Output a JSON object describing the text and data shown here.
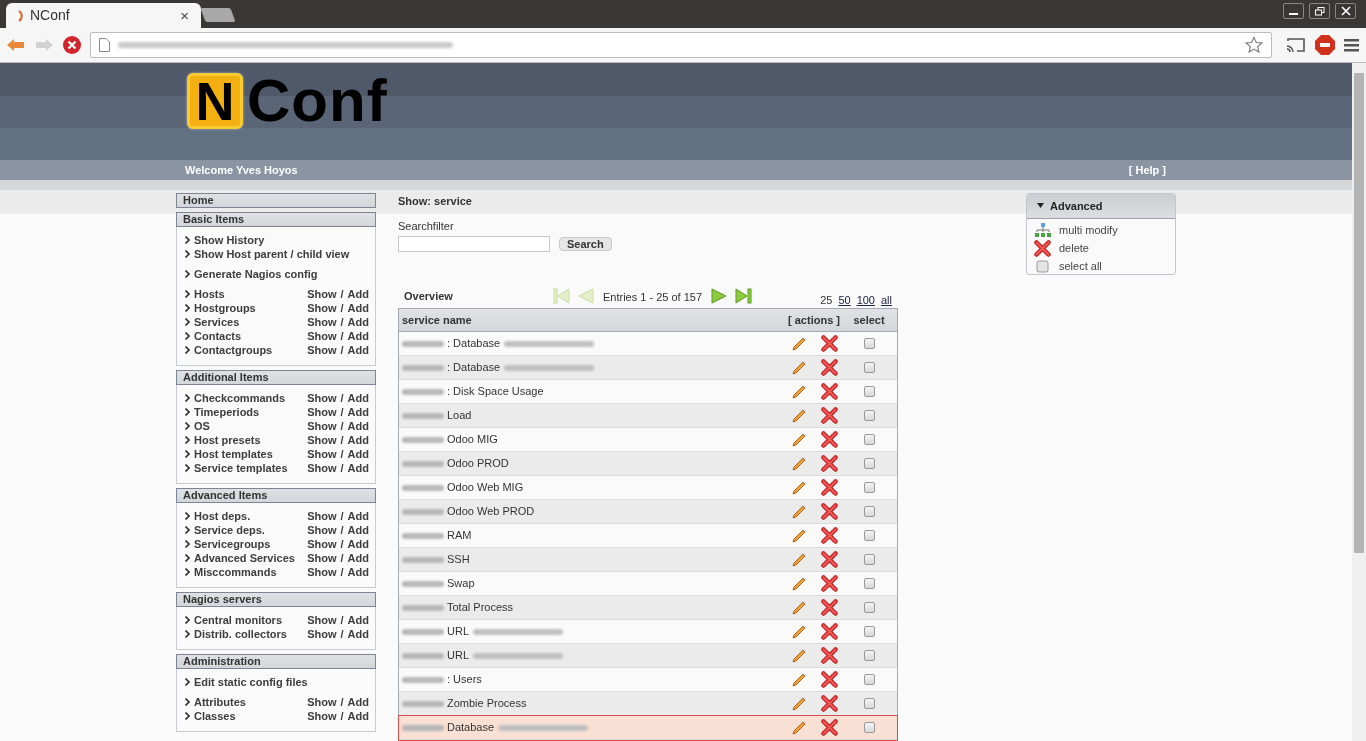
{
  "browser": {
    "tab_title": "NConf",
    "tab_close": "×"
  },
  "header": {
    "logo_letter": "N",
    "logo_rest": "Conf",
    "welcome": "Welcome Yves Hoyos",
    "help": "[ Help ]"
  },
  "sidebar": [
    {
      "title": "Home"
    },
    {
      "title": "Basic Items",
      "groups": [
        [
          {
            "label": "Show History"
          },
          {
            "label": "Show Host parent / child view"
          }
        ],
        [
          {
            "label": "Generate Nagios config"
          }
        ],
        [
          {
            "label": "Hosts",
            "show": "Show",
            "sep": "/",
            "add": "Add"
          },
          {
            "label": "Hostgroups",
            "show": "Show",
            "sep": "/",
            "add": "Add"
          },
          {
            "label": "Services",
            "show": "Show",
            "sep": "/",
            "add": "Add"
          },
          {
            "label": "Contacts",
            "show": "Show",
            "sep": "/",
            "add": "Add"
          },
          {
            "label": "Contactgroups",
            "show": "Show",
            "sep": "/",
            "add": "Add"
          }
        ]
      ]
    },
    {
      "title": "Additional Items",
      "groups": [
        [
          {
            "label": "Checkcommands",
            "show": "Show",
            "sep": "/",
            "add": "Add"
          },
          {
            "label": "Timeperiods",
            "show": "Show",
            "sep": "/",
            "add": "Add"
          },
          {
            "label": "OS",
            "show": "Show",
            "sep": "/",
            "add": "Add"
          },
          {
            "label": "Host presets",
            "show": "Show",
            "sep": "/",
            "add": "Add"
          },
          {
            "label": "Host templates",
            "show": "Show",
            "sep": "/",
            "add": "Add"
          },
          {
            "label": "Service templates",
            "show": "Show",
            "sep": "/",
            "add": "Add"
          }
        ]
      ]
    },
    {
      "title": "Advanced Items",
      "groups": [
        [
          {
            "label": "Host deps.",
            "show": "Show",
            "sep": "/",
            "add": "Add"
          },
          {
            "label": "Service deps.",
            "show": "Show",
            "sep": "/",
            "add": "Add"
          },
          {
            "label": "Servicegroups",
            "show": "Show",
            "sep": "/",
            "add": "Add"
          },
          {
            "label": "Advanced Services",
            "show": "Show",
            "sep": "/",
            "add": "Add"
          },
          {
            "label": "Misccommands",
            "show": "Show",
            "sep": "/",
            "add": "Add"
          }
        ]
      ]
    },
    {
      "title": "Nagios servers",
      "groups": [
        [
          {
            "label": "Central monitors",
            "show": "Show",
            "sep": "/",
            "add": "Add"
          },
          {
            "label": "Distrib. collectors",
            "show": "Show",
            "sep": "/",
            "add": "Add"
          }
        ]
      ]
    },
    {
      "title": "Administration",
      "groups": [
        [
          {
            "label": "Edit static config files"
          }
        ],
        [
          {
            "label": "Attributes",
            "show": "Show",
            "sep": "/",
            "add": "Add"
          },
          {
            "label": "Classes",
            "show": "Show",
            "sep": "/",
            "add": "Add"
          }
        ]
      ]
    }
  ],
  "main": {
    "heading": "Show: service",
    "search_label": "Searchfilter",
    "search_button": "Search",
    "overview": "Overview",
    "pager": {
      "nav": [
        {
          "kind": "first",
          "disabled": true
        },
        {
          "kind": "prev",
          "disabled": true
        }
      ],
      "entries": "Entries 1 - 25 of 157",
      "nav_after": [
        {
          "kind": "next",
          "disabled": false
        },
        {
          "kind": "last",
          "disabled": false
        }
      ]
    },
    "page_sizes": [
      {
        "label": "25",
        "selected": true
      },
      {
        "label": "50",
        "selected": false
      },
      {
        "label": "100",
        "selected": false
      },
      {
        "label": "all",
        "selected": false
      }
    ],
    "columns": [
      "service name",
      "[ actions ]",
      "select"
    ],
    "rows": [
      {
        "name": ": Database",
        "suffix_blurred": true,
        "highlighted": false,
        "checked": false
      },
      {
        "name": ": Database",
        "suffix_blurred": true,
        "highlighted": false,
        "checked": false
      },
      {
        "name": ": Disk Space Usage",
        "suffix_blurred": false,
        "highlighted": false,
        "checked": false
      },
      {
        "name": "Load",
        "suffix_blurred": false,
        "highlighted": false,
        "checked": false
      },
      {
        "name": "Odoo MIG",
        "suffix_blurred": false,
        "highlighted": false,
        "checked": false
      },
      {
        "name": "Odoo PROD",
        "suffix_blurred": false,
        "highlighted": false,
        "checked": false
      },
      {
        "name": "Odoo Web MIG",
        "suffix_blurred": false,
        "highlighted": false,
        "checked": false
      },
      {
        "name": "Odoo Web PROD",
        "suffix_blurred": false,
        "highlighted": false,
        "checked": false
      },
      {
        "name": "RAM",
        "suffix_blurred": false,
        "highlighted": false,
        "checked": false
      },
      {
        "name": "SSH",
        "suffix_blurred": false,
        "highlighted": false,
        "checked": false
      },
      {
        "name": "Swap",
        "suffix_blurred": false,
        "highlighted": false,
        "checked": false
      },
      {
        "name": "Total Process",
        "suffix_blurred": false,
        "highlighted": false,
        "checked": false
      },
      {
        "name": "URL",
        "suffix_blurred": true,
        "highlighted": false,
        "checked": false
      },
      {
        "name": "URL",
        "suffix_blurred": true,
        "highlighted": false,
        "checked": false
      },
      {
        "name": ": Users",
        "suffix_blurred": false,
        "highlighted": false,
        "checked": false
      },
      {
        "name": "Zombie Process",
        "suffix_blurred": false,
        "highlighted": false,
        "checked": false
      },
      {
        "name": "Database",
        "suffix_blurred": true,
        "highlighted": true,
        "checked": false
      }
    ]
  },
  "advanced": {
    "title": "Advanced",
    "expanded": true,
    "items": [
      {
        "kind": "multi",
        "label": "multi modify"
      },
      {
        "kind": "delete",
        "label": "delete"
      },
      {
        "kind": "selectall",
        "label": "select all",
        "checked": false
      }
    ]
  }
}
